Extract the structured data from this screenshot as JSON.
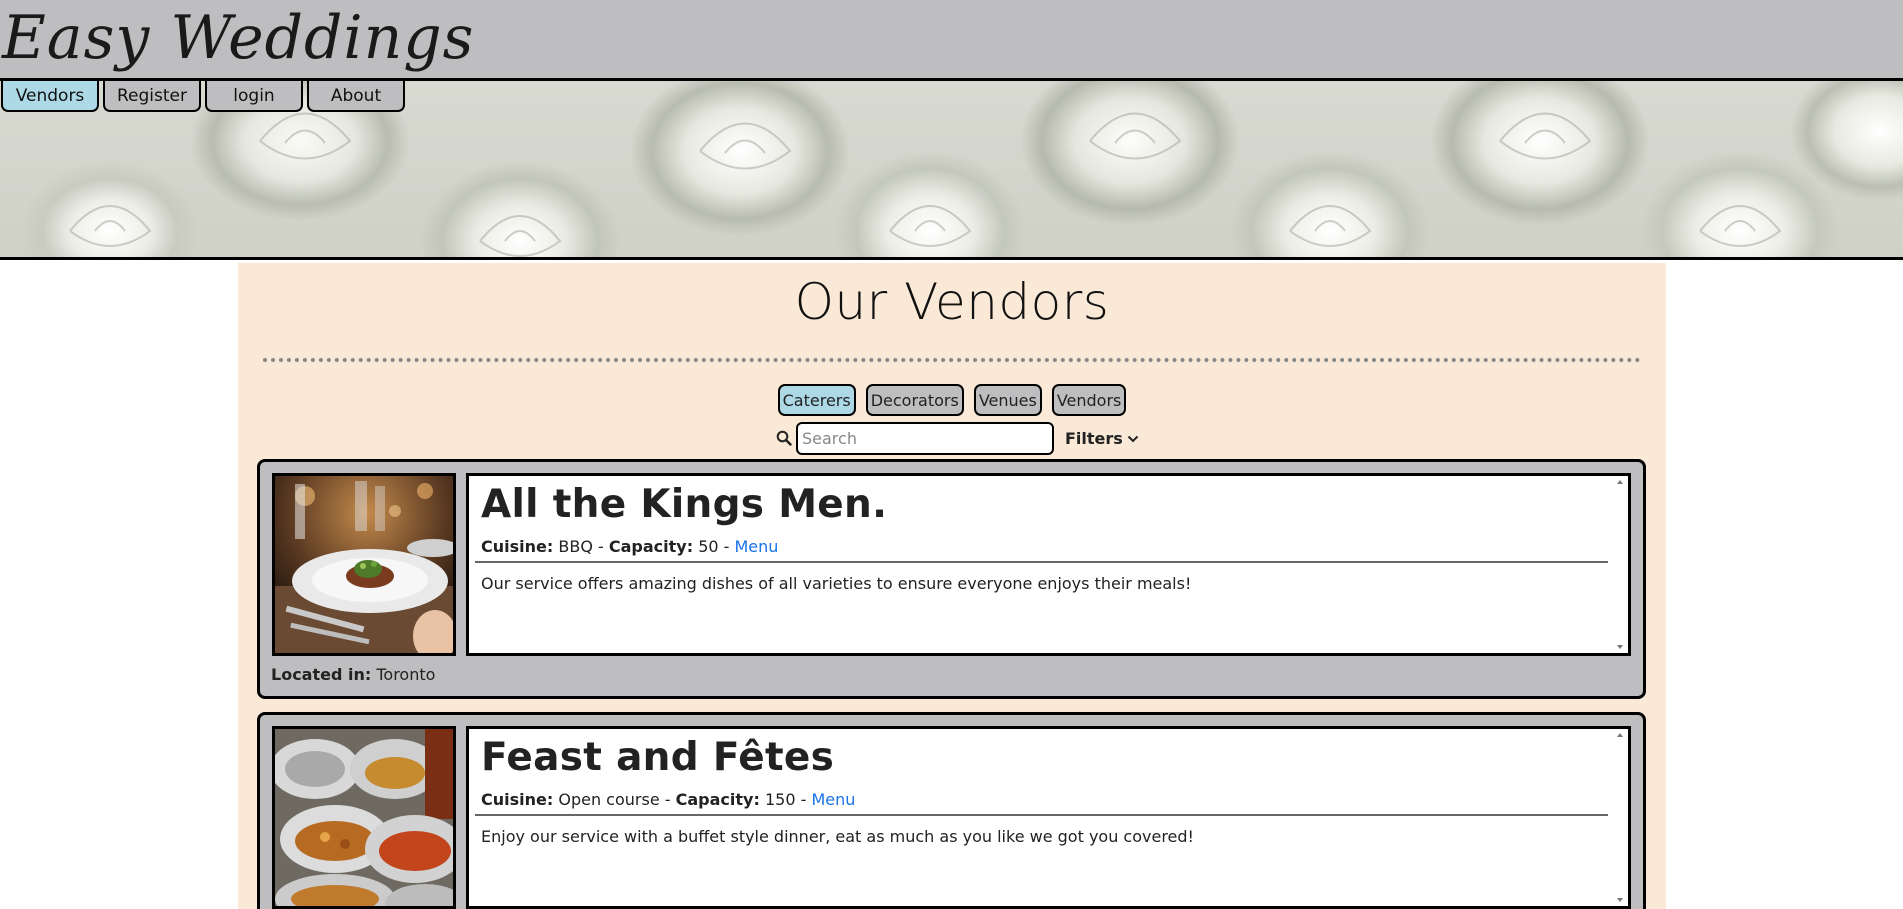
{
  "header": {
    "title": "Easy Weddings"
  },
  "nav": {
    "tabs": [
      {
        "label": "Vendors",
        "active": true
      },
      {
        "label": "Register",
        "active": false
      },
      {
        "label": "login",
        "active": false
      },
      {
        "label": "About",
        "active": false
      }
    ]
  },
  "main": {
    "title": "Our Vendors",
    "filter_tabs": [
      {
        "label": "Caterers",
        "active": true
      },
      {
        "label": "Decorators",
        "active": false
      },
      {
        "label": "Venues",
        "active": false
      },
      {
        "label": "Vendors",
        "active": false
      }
    ],
    "search": {
      "placeholder": "Search",
      "value": ""
    },
    "filters_label": "Filters"
  },
  "vendors": [
    {
      "name": "All the Kings Men.",
      "cuisine_label": "Cuisine:",
      "cuisine": "BBQ",
      "capacity_label": "Capacity:",
      "capacity": "50",
      "menu_label": "Menu",
      "description": "Our service offers amazing dishes of all varieties to ensure everyone enjoys their meals!",
      "location_label": "Located in:",
      "location": "Toronto"
    },
    {
      "name": "Feast and Fêtes",
      "cuisine_label": "Cuisine:",
      "cuisine": "Open course",
      "capacity_label": "Capacity:",
      "capacity": "150",
      "menu_label": "Menu",
      "description": "Enjoy our service with a buffet style dinner, eat as much as you like we got you covered!"
    }
  ],
  "colors": {
    "header_bg": "#bebdbf",
    "active_tab": "#add8e6",
    "panel_bg": "#f9e9d6",
    "link": "#1a73e8"
  }
}
